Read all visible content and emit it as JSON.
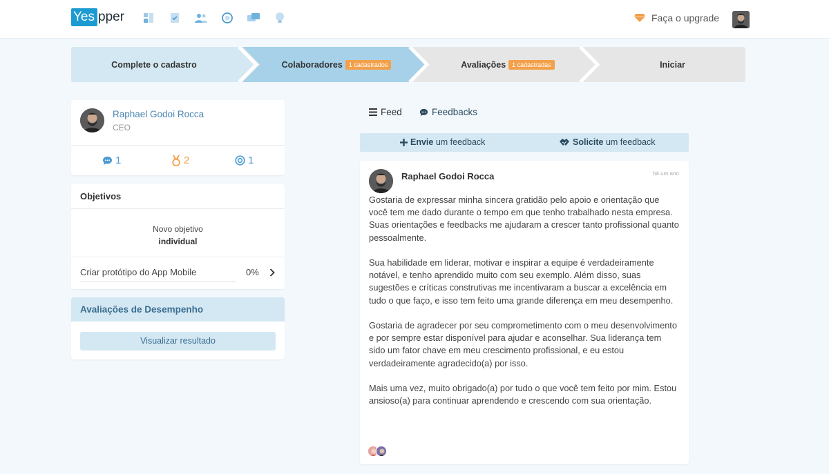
{
  "brand": {
    "logo_box": "Yes",
    "logo_rest": "pper",
    "accent": "#1b9bd1"
  },
  "topbar": {
    "nav_icons": [
      "dashboard-icon",
      "tasks-icon",
      "team-icon",
      "target-icon",
      "chat-icon",
      "idea-icon"
    ],
    "upgrade_label": "Faça o upgrade",
    "upgrade_icon": "diamond-icon"
  },
  "stepper": {
    "steps": [
      {
        "label": "Complete o cadastro",
        "badge": ""
      },
      {
        "label": "Colaboradores",
        "badge": "1 cadastrados"
      },
      {
        "label": "Avaliações",
        "badge": "1 cadastradas"
      },
      {
        "label": "Iniciar",
        "badge": ""
      }
    ]
  },
  "profile": {
    "name": "Raphael Godoi Rocca",
    "role": "CEO",
    "stats": {
      "feedbacks": "1",
      "medals": "2",
      "goals": "1"
    }
  },
  "objectives": {
    "title": "Objetivos",
    "new_line1": "Novo objetivo",
    "new_line2": "individual",
    "item": {
      "label": "Criar protótipo do App Mobile",
      "progress": "0%"
    }
  },
  "evaluations": {
    "title": "Avaliações de Desempenho",
    "button": "Visualizar resultado"
  },
  "feed": {
    "tabs": {
      "feed": "Feed",
      "feedbacks": "Feedbacks"
    },
    "actions": {
      "send_bold": "Envie",
      "send_rest": " um feedback",
      "request_bold": "Solicite",
      "request_rest": " um feedback"
    },
    "post": {
      "author": "Raphael Godoi Rocca",
      "time": "há um ano",
      "paragraphs": [
        "Gostaria de expressar minha sincera gratidão pelo apoio e orientação que você tem me dado durante o tempo em que tenho trabalhado nesta empresa. Suas orientações e feedbacks me ajudaram a crescer tanto profissional quanto pessoalmente.",
        "Sua habilidade em liderar, motivar e inspirar a equipe é verdadeiramente notável, e tenho aprendido muito com seu exemplo. Além disso, suas sugestões e críticas construtivas me incentivaram a buscar a excelência em tudo o que faço, e isso tem feito uma grande diferença em meu desempenho.",
        "Gostaria de agradecer por seu comprometimento com o meu desenvolvimento e por sempre estar disponível para ajudar e aconselhar. Sua liderança tem sido um fator chave em meu crescimento profissional, e eu estou verdadeiramente agradecido(a) por isso.",
        "Mais uma vez, muito obrigado(a) por tudo o que você tem feito por mim. Estou ansioso(a) para continuar aprendendo e crescendo com sua orientação."
      ]
    }
  }
}
